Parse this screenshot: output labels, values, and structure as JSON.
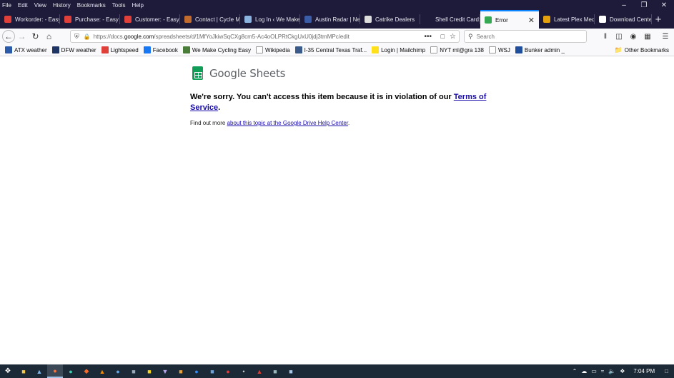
{
  "menu": [
    "File",
    "Edit",
    "View",
    "History",
    "Bookmarks",
    "Tools",
    "Help"
  ],
  "tabs": [
    {
      "title": "Workorder: - Easy",
      "icon": "drop-icon",
      "color": "#e0403a"
    },
    {
      "title": "Purchase: - Easy S",
      "icon": "drop-icon",
      "color": "#e0403a"
    },
    {
      "title": "Customer: - Easy",
      "icon": "drop-icon",
      "color": "#e0403a"
    },
    {
      "title": "Contact | Cycle M",
      "icon": "bike-icon",
      "color": "#c26b2e"
    },
    {
      "title": "Log In ‹ We Make",
      "icon": "page-icon",
      "color": "#8bb4e0"
    },
    {
      "title": "Austin Radar | Ne",
      "icon": "radar-icon",
      "color": "#3b5da8"
    },
    {
      "title": "Catrike Dealers",
      "icon": "trike-icon",
      "color": "#dddddd"
    },
    {
      "title": "Shell Credit Card: Cre",
      "icon": "blank-icon",
      "color": "#1e1b3a"
    },
    {
      "title": "Error",
      "icon": "drive-icon",
      "color": "#34a853",
      "active": true
    },
    {
      "title": "Latest Plex Media",
      "icon": "plex-icon",
      "color": "#e5a00d"
    },
    {
      "title": "Download Center",
      "icon": "s-icon",
      "color": "#ffffff"
    }
  ],
  "url": {
    "prefix": "https://docs.",
    "domain": "google.com",
    "path": "/spreadsheets/d/1MfYoJkiwSqCXg8cm5-Ac4oOLPRtCkgUxU0jdj3tmMPc/edit"
  },
  "search_placeholder": "Search",
  "bookmarks": [
    {
      "label": "ATX weather",
      "icon": "weather-icon",
      "color": "#2a5aa8"
    },
    {
      "label": "DFW weather",
      "icon": "weather-icon",
      "color": "#1f3566"
    },
    {
      "label": "Lightspeed",
      "icon": "drop-icon",
      "color": "#e0403a"
    },
    {
      "label": "Facebook",
      "icon": "facebook-icon",
      "color": "#1877f2"
    },
    {
      "label": "We Make Cycling Easy",
      "icon": "cycling-icon",
      "color": "#4a7c3a"
    },
    {
      "label": "Wikipedia",
      "icon": "wikipedia-icon",
      "color": "#ffffff"
    },
    {
      "label": "I-35 Central Texas Traf...",
      "icon": "shield-icon",
      "color": "#3a5a8c"
    },
    {
      "label": "Login | Mailchimp",
      "icon": "mailchimp-icon",
      "color": "#ffe01b"
    },
    {
      "label": "NYT ml@gra 138",
      "icon": "nyt-icon",
      "color": "#ffffff"
    },
    {
      "label": "WSJ",
      "icon": "wsj-icon",
      "color": "#ffffff"
    },
    {
      "label": "Bunker admin _",
      "icon": "bunker-icon",
      "color": "#1f4f9c"
    }
  ],
  "other_bookmarks": "Other Bookmarks",
  "page": {
    "logo_text": "Google Sheets",
    "error_text": "We're sorry. You can't access this item because it is in violation of our ",
    "tos_link": "Terms of Service",
    "period": ".",
    "find_more": "Find out more ",
    "help_link": "about this topic at the Google Drive Help Center",
    "help_period": "."
  },
  "taskbar": {
    "time": "7:04 PM"
  }
}
